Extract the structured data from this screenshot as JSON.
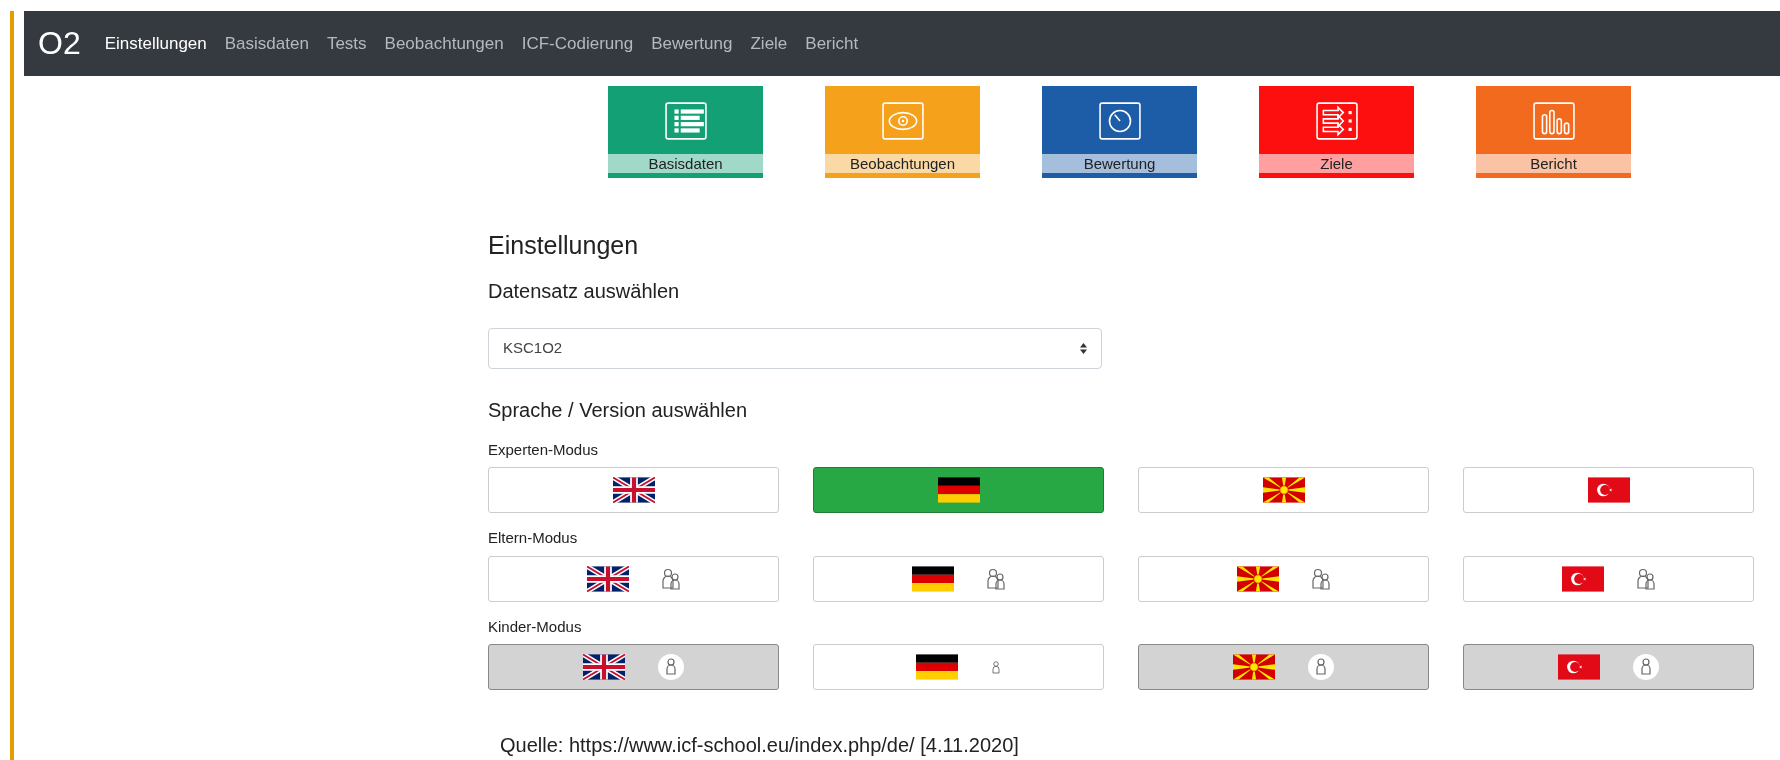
{
  "navbar": {
    "brand": "O2",
    "items": [
      {
        "label": "Einstellungen",
        "selected": true
      },
      {
        "label": "Basisdaten",
        "selected": false
      },
      {
        "label": "Tests",
        "selected": false
      },
      {
        "label": "Beobachtungen",
        "selected": false
      },
      {
        "label": "ICF-Codierung",
        "selected": false
      },
      {
        "label": "Bewertung",
        "selected": false
      },
      {
        "label": "Ziele",
        "selected": false
      },
      {
        "label": "Bericht",
        "selected": false
      }
    ]
  },
  "tiles": [
    {
      "label": "Basisdaten",
      "kind": "list",
      "color": "#14a075"
    },
    {
      "label": "Beobachtungen",
      "kind": "eye",
      "color": "#f5a11c"
    },
    {
      "label": "Bewertung",
      "kind": "gauge",
      "color": "#1d5ca6"
    },
    {
      "label": "Ziele",
      "kind": "arrows",
      "color": "#fe0f0f"
    },
    {
      "label": "Bericht",
      "kind": "bars",
      "color": "#f26a1e"
    }
  ],
  "settings": {
    "title": "Einstellungen",
    "dataset_label": "Datensatz auswählen",
    "dataset_value": "KSC1O2",
    "language_label": "Sprache / Version auswählen",
    "modes": [
      {
        "label": "Experten-Modus",
        "kind": "expert",
        "buttons": [
          {
            "kind": "uk",
            "selected": false,
            "disabled": false
          },
          {
            "kind": "de",
            "selected": true,
            "disabled": false
          },
          {
            "kind": "mk",
            "selected": false,
            "disabled": false
          },
          {
            "kind": "tr",
            "selected": false,
            "disabled": false
          }
        ]
      },
      {
        "label": "Eltern-Modus",
        "kind": "parents",
        "buttons": [
          {
            "kind": "uk",
            "selected": false,
            "disabled": false
          },
          {
            "kind": "de",
            "selected": false,
            "disabled": false
          },
          {
            "kind": "mk",
            "selected": false,
            "disabled": false
          },
          {
            "kind": "tr",
            "selected": false,
            "disabled": false
          }
        ]
      },
      {
        "label": "Kinder-Modus",
        "kind": "child",
        "buttons": [
          {
            "kind": "uk",
            "selected": false,
            "disabled": true
          },
          {
            "kind": "de",
            "selected": false,
            "disabled": false
          },
          {
            "kind": "mk",
            "selected": false,
            "disabled": true
          },
          {
            "kind": "tr",
            "selected": false,
            "disabled": true
          }
        ]
      }
    ]
  },
  "source": "Quelle: https://www.icf-school.eu/index.php/de/ [4.11.2020]"
}
